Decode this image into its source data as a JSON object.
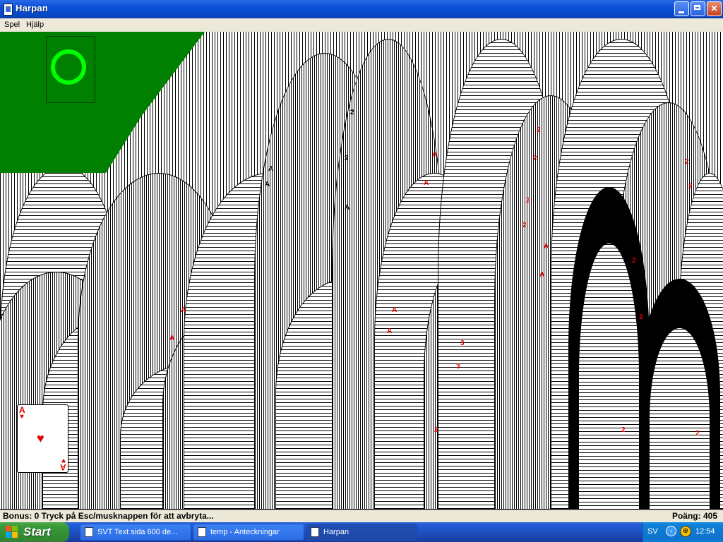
{
  "window": {
    "title": "Harpan",
    "controls": [
      "minimize",
      "maximize",
      "close"
    ]
  },
  "menu": {
    "items": [
      {
        "label": "Spel"
      },
      {
        "label": "Hjälp"
      }
    ]
  },
  "game": {
    "empty_slot_icon": "green-ring-icon",
    "visible_card": {
      "rank": "A",
      "suit": "♥"
    },
    "trail_ranks": [
      "A",
      "2",
      "3"
    ],
    "colors": {
      "felt": "#008000",
      "ring": "#00ff00",
      "red_suit": "#e00000"
    }
  },
  "status": {
    "left": "Bonus: 0  Tryck på Esc/musknappen för att avbryta...",
    "right": "Poäng: 405"
  },
  "taskbar": {
    "start_label": "Start",
    "tasks": [
      {
        "label": "SVT Text sida 600 de...",
        "active": false
      },
      {
        "label": "temp - Anteckningar",
        "active": false
      },
      {
        "label": "Harpan",
        "active": true
      }
    ],
    "tray": {
      "language": "SV",
      "clock": "12:54"
    }
  }
}
